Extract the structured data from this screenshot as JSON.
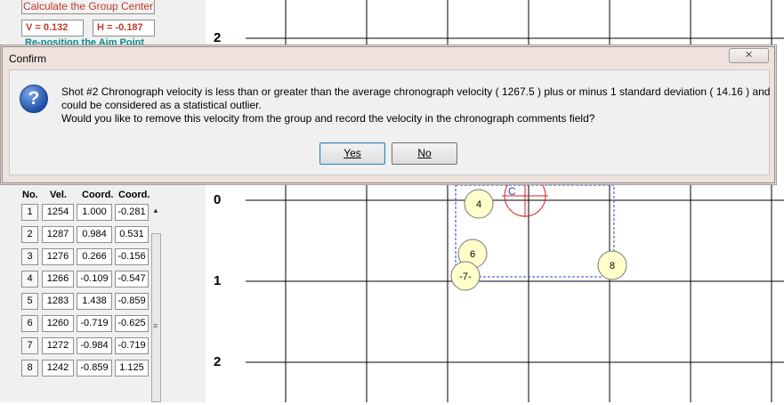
{
  "left_panel": {
    "calc_button": "Calculate the Group Center",
    "v_value": "V = 0.132",
    "h_value": "H = -0.187",
    "reposition_label": "Re-position the Aim Point",
    "table": {
      "headers": [
        "No.",
        "Vel.",
        "Coord.",
        "Coord."
      ],
      "rows": [
        [
          "1",
          "1254",
          "1.000",
          "-0.281"
        ],
        [
          "2",
          "1287",
          "0.984",
          "0.531"
        ],
        [
          "3",
          "1276",
          "0.266",
          "-0.156"
        ],
        [
          "4",
          "1266",
          "-0.109",
          "-0.547"
        ],
        [
          "5",
          "1283",
          "1.438",
          "-0.859"
        ],
        [
          "6",
          "1260",
          "-0.719",
          "-0.625"
        ],
        [
          "7",
          "1272",
          "-0.984",
          "-0.719"
        ],
        [
          "8",
          "1242",
          "-0.859",
          "1.125"
        ]
      ]
    }
  },
  "plot": {
    "axis_labels": [
      "2",
      "0",
      "1",
      "2"
    ],
    "shot_markers": [
      "4",
      "6",
      "-7-",
      "8"
    ],
    "center_label": "C"
  },
  "dialog": {
    "title": "Confirm",
    "close_glyph": "✕",
    "icon": "question-icon",
    "message_lines": [
      "Shot #2 Chronograph velocity is less than or greater than the average chronograph velocity ( 1267.5 ) plus or minus 1 standard deviation ( 14.16 ) and",
      "could be considered as a statistical outlier.",
      "Would you like to remove this velocity from the group and record the velocity in the chronograph comments field?"
    ],
    "yes_button": "Yes",
    "no_button": "No"
  },
  "colors": {
    "accent_red": "#c0392b",
    "teal": "#0b8a8a",
    "grid_blue": "#2c3fc7"
  }
}
